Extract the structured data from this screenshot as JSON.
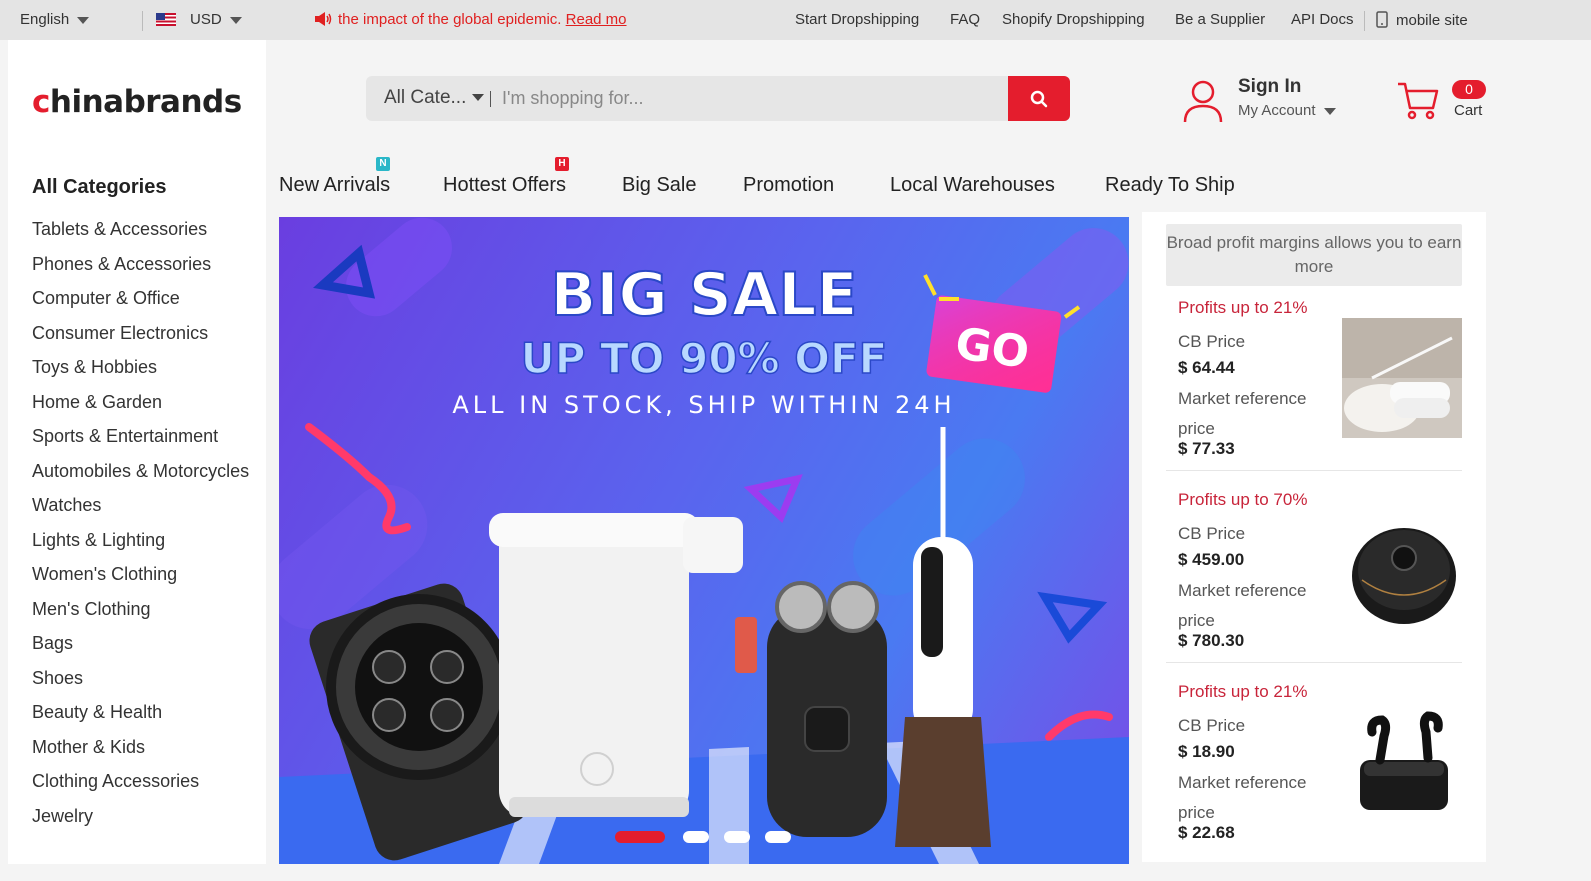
{
  "topbar": {
    "language": "English",
    "currency": "USD",
    "notice_text": "the impact of the global epidemic.",
    "notice_link": "Read mo",
    "links": [
      "Start Dropshipping",
      "FAQ",
      "Shopify Dropshipping",
      "Be a Supplier",
      "API Docs"
    ],
    "mobile": "mobile site"
  },
  "logo": {
    "c": "c",
    "rest": "hinabrands"
  },
  "search": {
    "category": "All Cate...",
    "placeholder": "I'm shopping for..."
  },
  "account": {
    "sign_in": "Sign In",
    "my_account": "My Account"
  },
  "cart": {
    "count": "0",
    "label": "Cart"
  },
  "sidebar": {
    "title": "All Categories",
    "items": [
      "Tablets & Accessories",
      "Phones & Accessories",
      "Computer & Office",
      "Consumer Electronics",
      "Toys & Hobbies",
      "Home & Garden",
      "Sports & Entertainment",
      "Automobiles & Motorcycles",
      "Watches",
      "Lights & Lighting",
      "Women's Clothing",
      "Men's Clothing",
      "Bags",
      "Shoes",
      "Beauty & Health",
      "Mother & Kids",
      "Clothing Accessories",
      "Jewelry"
    ]
  },
  "nav": {
    "items": [
      "New Arrivals",
      "Hottest Offers",
      "Big Sale",
      "Promotion",
      "Local Warehouses",
      "Ready To Ship"
    ],
    "tags": {
      "new": "N",
      "hot": "H"
    }
  },
  "banner": {
    "title": "BIG SALE",
    "subtitle": "UP TO 90% OFF",
    "tagline": "ALL IN STOCK, SHIP WITHIN 24H",
    "go": "GO",
    "slides": 4,
    "active_slide": 1
  },
  "panel": {
    "promo": "Broad profit margins allows you to earn more",
    "products": [
      {
        "profit": "Profits up to 21%",
        "cb_label": "CB Price",
        "cb_price": "$ 64.44",
        "market_label": "Market reference price",
        "market_price": "$ 77.33",
        "icon": "towels-image"
      },
      {
        "profit": "Profits up to 70%",
        "cb_label": "CB Price",
        "cb_price": "$ 459.00",
        "market_label": "Market reference price",
        "market_price": "$ 780.30",
        "icon": "robot-vacuum-image"
      },
      {
        "profit": "Profits up to 21%",
        "cb_label": "CB Price",
        "cb_price": "$ 18.90",
        "market_label": "Market reference price",
        "market_price": "$ 22.68",
        "icon": "earbuds-image"
      }
    ]
  },
  "colors": {
    "brand": "#e41d2d",
    "profit": "#c8243a",
    "new_tag": "#2ab7c8",
    "hot_tag": "#e41d2d"
  }
}
